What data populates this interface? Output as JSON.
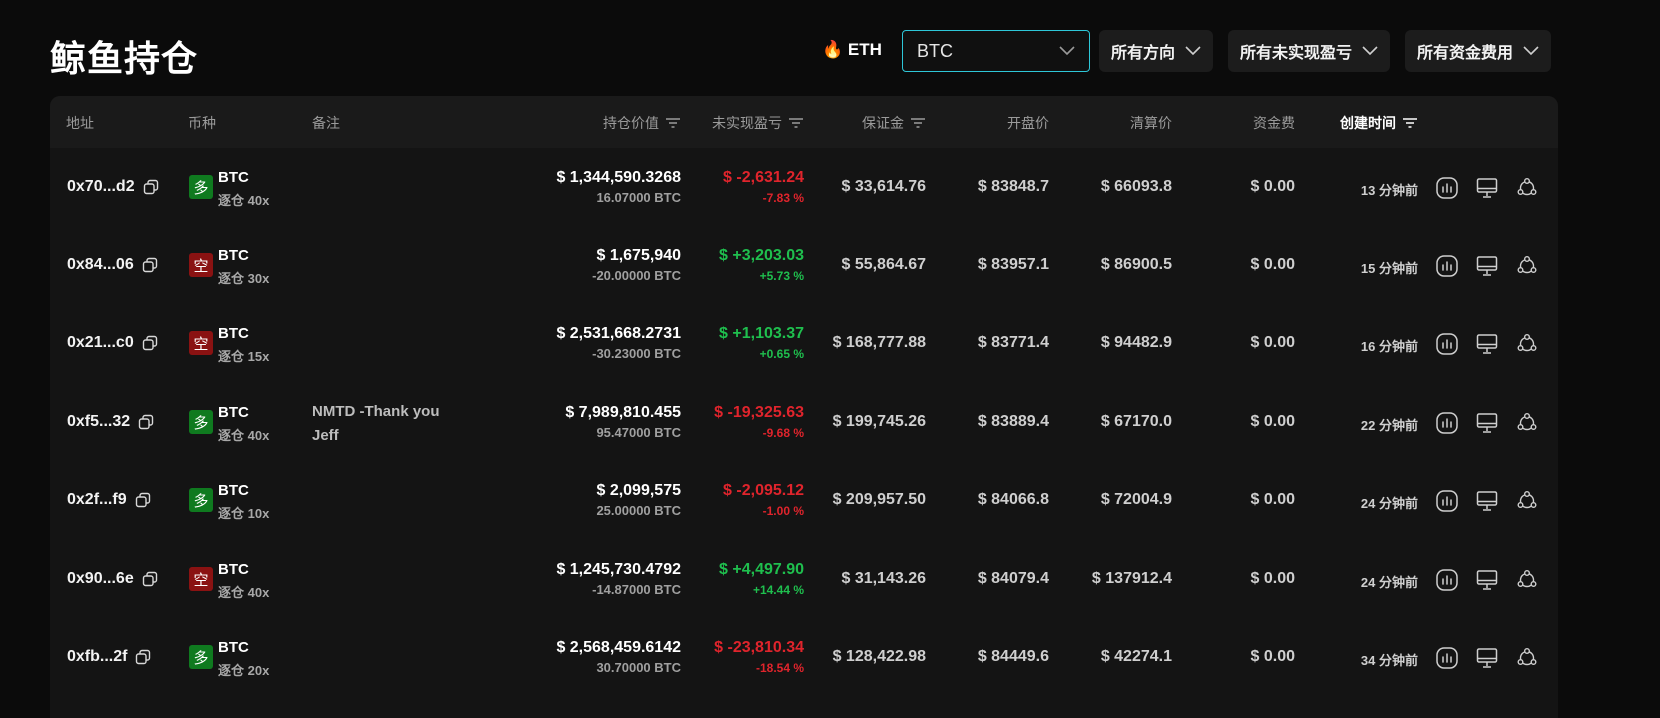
{
  "header": {
    "title": "鲸鱼持仓",
    "eth_label": "🔥 ETH",
    "coin_select_value": "BTC",
    "direction_filter": "所有方向",
    "pnl_filter": "所有未实现盈亏",
    "funding_filter": "所有资金费用"
  },
  "table": {
    "columns": {
      "address": "地址",
      "coin": "币种",
      "note": "备注",
      "position_value": "持仓价值",
      "unrealized_pnl": "未实现盈亏",
      "margin": "保证金",
      "entry_price": "开盘价",
      "liquidation_price": "清算价",
      "funding_fee": "资金费",
      "created_time": "创建时间"
    },
    "rows": [
      {
        "address": "0x70...d2",
        "direction": "多",
        "side": "long",
        "coin": "BTC",
        "leverage": "逐仓 40x",
        "note": "",
        "value": "$ 1,344,590.3268",
        "size": "16.07000 BTC",
        "pnl": "$ -2,631.24",
        "pnl_pct": "-7.83 %",
        "pnl_sign": "neg",
        "margin": "$ 33,614.76",
        "entry": "$ 83848.7",
        "liq": "$ 66093.8",
        "funding": "$ 0.00",
        "time": "13 分钟前"
      },
      {
        "address": "0x84...06",
        "direction": "空",
        "side": "short",
        "coin": "BTC",
        "leverage": "逐仓 30x",
        "note": "",
        "value": "$ 1,675,940",
        "size": "-20.00000 BTC",
        "pnl": "$ +3,203.03",
        "pnl_pct": "+5.73 %",
        "pnl_sign": "pos",
        "margin": "$ 55,864.67",
        "entry": "$ 83957.1",
        "liq": "$ 86900.5",
        "funding": "$ 0.00",
        "time": "15 分钟前"
      },
      {
        "address": "0x21...c0",
        "direction": "空",
        "side": "short",
        "coin": "BTC",
        "leverage": "逐仓 15x",
        "note": "",
        "value": "$ 2,531,668.2731",
        "size": "-30.23000 BTC",
        "pnl": "$ +1,103.37",
        "pnl_pct": "+0.65 %",
        "pnl_sign": "pos",
        "margin": "$ 168,777.88",
        "entry": "$ 83771.4",
        "liq": "$ 94482.9",
        "funding": "$ 0.00",
        "time": "16 分钟前"
      },
      {
        "address": "0xf5...32",
        "direction": "多",
        "side": "long",
        "coin": "BTC",
        "leverage": "逐仓 40x",
        "note": "NMTD -Thank you Jeff",
        "value": "$ 7,989,810.455",
        "size": "95.47000 BTC",
        "pnl": "$ -19,325.63",
        "pnl_pct": "-9.68 %",
        "pnl_sign": "neg",
        "margin": "$ 199,745.26",
        "entry": "$ 83889.4",
        "liq": "$ 67170.0",
        "funding": "$ 0.00",
        "time": "22 分钟前"
      },
      {
        "address": "0x2f...f9",
        "direction": "多",
        "side": "long",
        "coin": "BTC",
        "leverage": "逐仓 10x",
        "note": "",
        "value": "$ 2,099,575",
        "size": "25.00000 BTC",
        "pnl": "$ -2,095.12",
        "pnl_pct": "-1.00 %",
        "pnl_sign": "neg",
        "margin": "$ 209,957.50",
        "entry": "$ 84066.8",
        "liq": "$ 72004.9",
        "funding": "$ 0.00",
        "time": "24 分钟前"
      },
      {
        "address": "0x90...6e",
        "direction": "空",
        "side": "short",
        "coin": "BTC",
        "leverage": "逐仓 40x",
        "note": "",
        "value": "$ 1,245,730.4792",
        "size": "-14.87000 BTC",
        "pnl": "$ +4,497.90",
        "pnl_pct": "+14.44 %",
        "pnl_sign": "pos",
        "margin": "$ 31,143.26",
        "entry": "$ 84079.4",
        "liq": "$ 137912.4",
        "funding": "$ 0.00",
        "time": "24 分钟前"
      },
      {
        "address": "0xfb...2f",
        "direction": "多",
        "side": "long",
        "coin": "BTC",
        "leverage": "逐仓 20x",
        "note": "",
        "value": "$ 2,568,459.6142",
        "size": "30.70000 BTC",
        "pnl": "$ -23,810.34",
        "pnl_pct": "-18.54 %",
        "pnl_sign": "neg",
        "margin": "$ 128,422.98",
        "entry": "$ 84449.6",
        "liq": "$ 42274.1",
        "funding": "$ 0.00",
        "time": "34 分钟前"
      }
    ]
  },
  "icons": {
    "copy": "copy-icon",
    "chart": "bar-chart-icon",
    "monitor": "monitor-icon",
    "share": "share-icon",
    "filter": "sort-filter-icon",
    "chevron": "chevron-down-icon"
  },
  "colors": {
    "accent": "#2ec7d8",
    "long": "#0f7a1f",
    "short": "#8a1212",
    "profit": "#1fbf4e",
    "loss": "#e0242c"
  }
}
